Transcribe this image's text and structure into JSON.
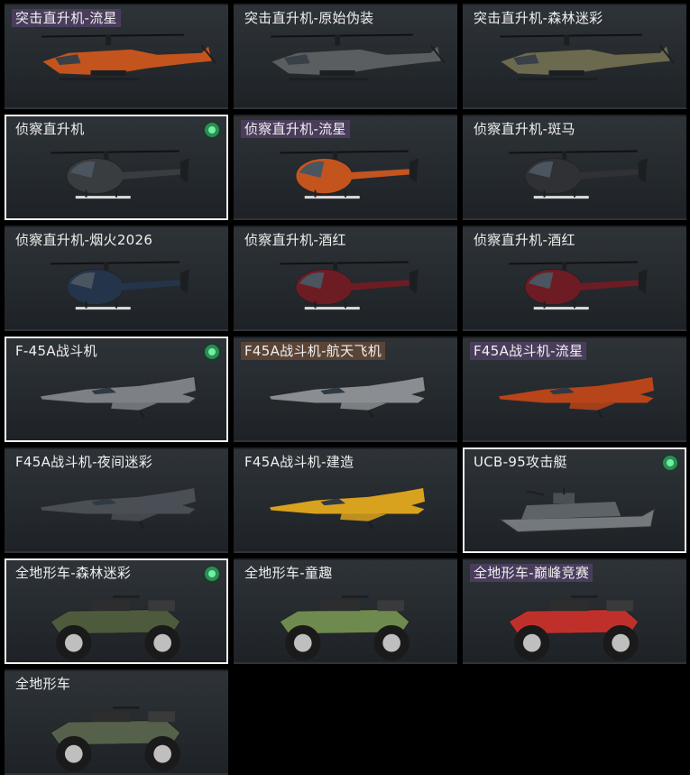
{
  "cards": [
    {
      "label": "突击直升机-流星",
      "tag": "purple",
      "equipped": false,
      "selected": false,
      "vehicle": "attack-helicopter",
      "skin": "meteor",
      "color": "#c4541e"
    },
    {
      "label": "突击直升机-原始伪装",
      "tag": "none",
      "equipped": false,
      "selected": false,
      "vehicle": "attack-helicopter",
      "skin": "original-camo",
      "color": "#5a5e60"
    },
    {
      "label": "突击直升机-森林迷彩",
      "tag": "none",
      "equipped": false,
      "selected": false,
      "vehicle": "attack-helicopter",
      "skin": "forest-camo",
      "color": "#6b6a4e"
    },
    {
      "label": "侦察直升机",
      "tag": "none",
      "equipped": true,
      "selected": true,
      "vehicle": "scout-helicopter",
      "skin": "default",
      "color": "#3a3d40"
    },
    {
      "label": "侦察直升机-流星",
      "tag": "purple",
      "equipped": false,
      "selected": false,
      "vehicle": "scout-helicopter",
      "skin": "meteor",
      "color": "#c4541e"
    },
    {
      "label": "侦察直升机-斑马",
      "tag": "none",
      "equipped": false,
      "selected": false,
      "vehicle": "scout-helicopter",
      "skin": "zebra",
      "color": "#2f3134"
    },
    {
      "label": "侦察直升机-烟火2026",
      "tag": "none",
      "equipped": false,
      "selected": false,
      "vehicle": "scout-helicopter",
      "skin": "fireworks-2026",
      "color": "#24344a"
    },
    {
      "label": "侦察直升机-酒红",
      "tag": "none",
      "equipped": false,
      "selected": false,
      "vehicle": "scout-helicopter",
      "skin": "wine-red",
      "color": "#6e1c24"
    },
    {
      "label": "侦察直升机-酒红",
      "tag": "none",
      "equipped": false,
      "selected": false,
      "vehicle": "scout-helicopter",
      "skin": "wine-red",
      "color": "#6e1c24"
    },
    {
      "label": "F-45A战斗机",
      "tag": "none",
      "equipped": true,
      "selected": true,
      "vehicle": "fighter-jet",
      "skin": "default",
      "color": "#7d8186"
    },
    {
      "label": "F45A战斗机-航天飞机",
      "tag": "bronze",
      "equipped": false,
      "selected": false,
      "vehicle": "fighter-jet",
      "skin": "space-shuttle",
      "color": "#8a8e92"
    },
    {
      "label": "F45A战斗机-流星",
      "tag": "purple",
      "equipped": false,
      "selected": false,
      "vehicle": "fighter-jet",
      "skin": "meteor",
      "color": "#b8441a"
    },
    {
      "label": "F45A战斗机-夜间迷彩",
      "tag": "none",
      "equipped": false,
      "selected": false,
      "vehicle": "fighter-jet",
      "skin": "night-camo",
      "color": "#4a4f56"
    },
    {
      "label": "F45A战斗机-建造",
      "tag": "none",
      "equipped": false,
      "selected": false,
      "vehicle": "fighter-jet",
      "skin": "construction",
      "color": "#d9a21e"
    },
    {
      "label": "UCB-95攻击艇",
      "tag": "none",
      "equipped": true,
      "selected": true,
      "vehicle": "attack-boat",
      "skin": "default",
      "color": "#74797e"
    },
    {
      "label": "全地形车-森林迷彩",
      "tag": "none",
      "equipped": true,
      "selected": true,
      "vehicle": "atv",
      "skin": "forest-camo",
      "color": "#4d5a3c"
    },
    {
      "label": "全地形车-童趣",
      "tag": "none",
      "equipped": false,
      "selected": false,
      "vehicle": "atv",
      "skin": "childlike",
      "color": "#6e8a4e"
    },
    {
      "label": "全地形车-巅峰竞赛",
      "tag": "purple",
      "equipped": false,
      "selected": false,
      "vehicle": "atv",
      "skin": "peak-racing",
      "color": "#c0302a"
    },
    {
      "label": "全地形车",
      "tag": "none",
      "equipped": false,
      "selected": false,
      "vehicle": "atv",
      "skin": "default",
      "color": "#55614a"
    }
  ]
}
